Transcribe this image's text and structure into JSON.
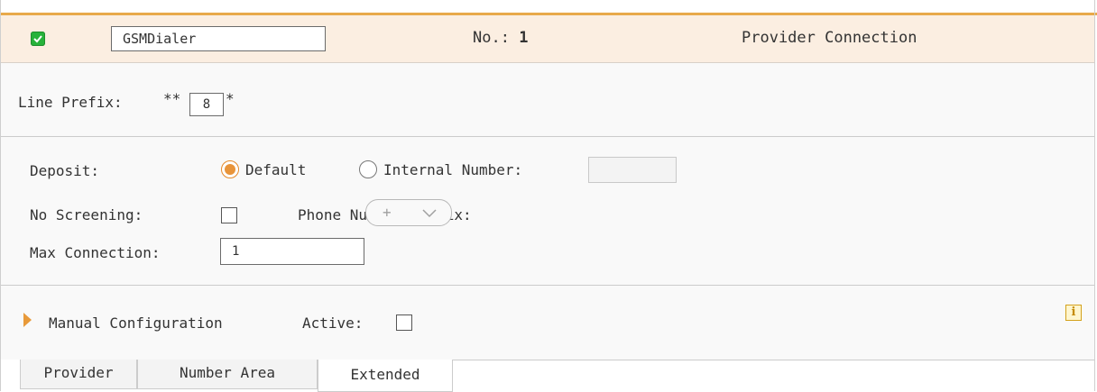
{
  "header": {
    "enabled": true,
    "name_value": "GSMDialer",
    "number_label": "No.:",
    "number_value": "1",
    "title": "Provider Connection"
  },
  "line_prefix": {
    "label": "Line Prefix:",
    "prefix_before": "**",
    "value": "8",
    "suffix_after": "*"
  },
  "deposit": {
    "label": "Deposit:",
    "options": [
      {
        "label": "Default",
        "selected": true
      },
      {
        "label": "Internal Number:",
        "selected": false
      }
    ],
    "internal_number_value": ""
  },
  "no_screening": {
    "label": "No Screening:",
    "checked": false
  },
  "phone_number_prefix": {
    "label": "Phone Number Prefix:",
    "value": "+"
  },
  "max_connection": {
    "label": "Max Connection:",
    "value": "1"
  },
  "manual_configuration": {
    "label": "Manual Configuration",
    "active_label": "Active:",
    "active_checked": false,
    "info_glyph": "i"
  },
  "tabs": [
    {
      "label": "Provider",
      "active": false
    },
    {
      "label": "Number Area",
      "active": false
    },
    {
      "label": "Extended",
      "active": true
    }
  ],
  "colors": {
    "accent": "#e8a94a",
    "header_bg": "#fbeee1",
    "enabled_green": "#27b23a",
    "radio_orange": "#e8943a"
  }
}
